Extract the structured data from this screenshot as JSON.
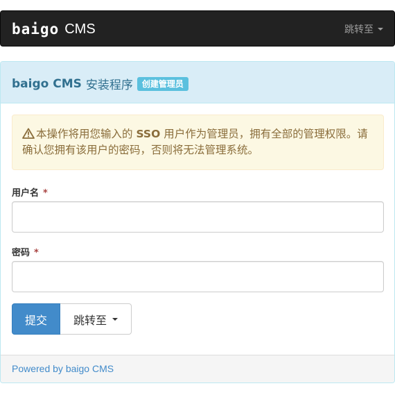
{
  "navbar": {
    "logo_text": "baigo",
    "brand_suffix": "CMS",
    "jump_label": "跳转至"
  },
  "panel": {
    "title_brand": "baigo CMS",
    "title_rest": "安装程序",
    "step_badge": "创建管理员"
  },
  "alert": {
    "icon": "warning-triangle-icon",
    "text_before": "本操作将用您输入的",
    "text_strong": "SSO",
    "text_after": "用户作为管理员，拥有全部的管理权限。请确认您拥有该用户的密码，否则将无法管理系统。"
  },
  "form": {
    "username_label": "用户名",
    "username_value": "",
    "password_label": "密码",
    "password_value": "",
    "required_mark": "*"
  },
  "buttons": {
    "submit_label": "提交",
    "jump_label": "跳转至"
  },
  "footer": {
    "link_text": "Powered by baigo CMS"
  },
  "colors": {
    "navbar_bg": "#222222",
    "panel_heading_bg": "#d9edf7",
    "alert_bg": "#fcf8e3",
    "primary": "#428bca",
    "badge": "#5bc0de"
  }
}
